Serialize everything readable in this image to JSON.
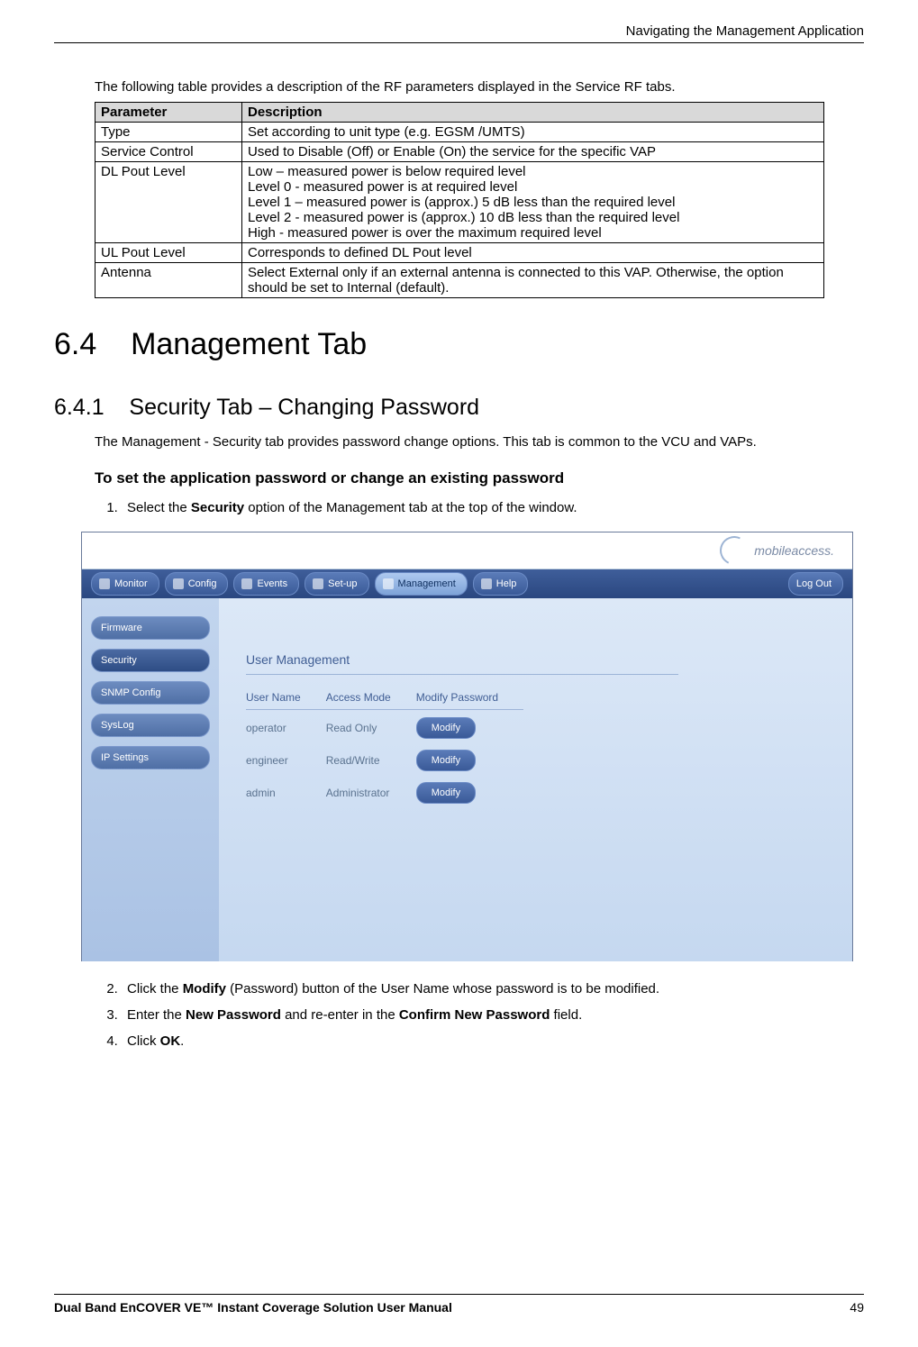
{
  "header": {
    "breadcrumb": "Navigating the Management Application"
  },
  "intro": "The following table provides a description of the RF parameters displayed in the Service RF tabs.",
  "table": {
    "head_param": "Parameter",
    "head_desc": "Description",
    "rows": [
      {
        "p": "Type",
        "d": "Set according to unit type (e.g. EGSM  /UMTS)"
      },
      {
        "p": "Service Control",
        "d": "Used to Disable (Off) or Enable (On) the service for the specific VAP"
      },
      {
        "p": "DL Pout Level",
        "d": "Low – measured power is below required level\nLevel 0 - measured power is at required level\nLevel 1 – measured power is (approx.) 5 dB less than the required level\nLevel 2 - measured power is (approx.) 10 dB less than the required level\nHigh -  measured power is over the maximum required level"
      },
      {
        "p": "UL Pout Level",
        "d": "Corresponds to defined DL Pout level"
      },
      {
        "p": "Antenna",
        "d": "Select External only if an external antenna is connected to this VAP. Otherwise, the option should be set to Internal (default)."
      }
    ]
  },
  "sections": {
    "h1_num": "6.4",
    "h1_title": "Management Tab",
    "h2_num": "6.4.1",
    "h2_title": "Security Tab – Changing Password",
    "p1": "The Management - Security tab provides password change options. This tab is common to the VCU and VAPs.",
    "bold": "To set the application password or change an existing password"
  },
  "steps": {
    "s1_a": "Select the ",
    "s1_b": "Security",
    "s1_c": " option of the Management tab at the top of the window.",
    "s2_a": "Click the ",
    "s2_b": "Modify",
    "s2_c": " (Password) button of the User Name whose password is to be modified.",
    "s3_a": "Enter the ",
    "s3_b": "New Password",
    "s3_c": " and re-enter in the ",
    "s3_d": "Confirm New Password",
    "s3_e": " field.",
    "s4_a": "Click ",
    "s4_b": "OK",
    "s4_c": "."
  },
  "app": {
    "logo": "mobileaccess.",
    "nav": {
      "monitor": "Monitor",
      "config": "Config",
      "events": "Events",
      "setup": "Set-up",
      "management": "Management",
      "help": "Help",
      "logout": "Log Out"
    },
    "side": {
      "firmware": "Firmware",
      "security": "Security",
      "snmp": "SNMP Config",
      "syslog": "SysLog",
      "ip": "IP Settings"
    },
    "panel": {
      "title": "User Management",
      "cols": {
        "c1": "User Name",
        "c2": "Access Mode",
        "c3": "Modify Password"
      },
      "rows": [
        {
          "user": "operator",
          "mode": "Read Only",
          "btn": "Modify"
        },
        {
          "user": "engineer",
          "mode": "Read/Write",
          "btn": "Modify"
        },
        {
          "user": "admin",
          "mode": "Administrator",
          "btn": "Modify"
        }
      ]
    }
  },
  "footer": {
    "title": "Dual Band EnCOVER VE™ Instant Coverage Solution User Manual",
    "page": "49"
  }
}
